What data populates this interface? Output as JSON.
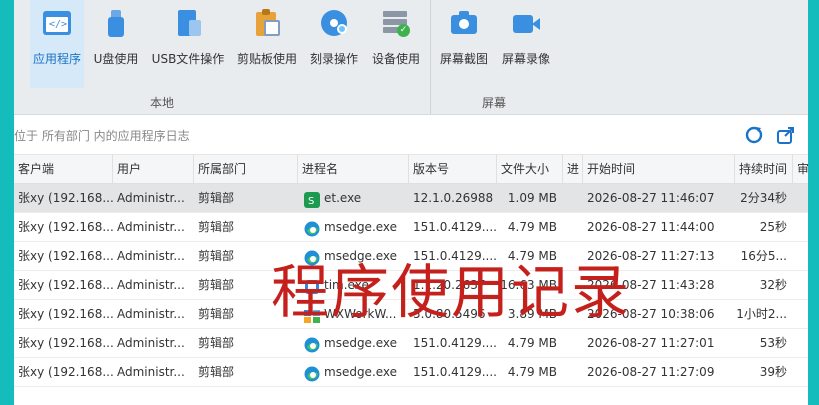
{
  "ribbon": {
    "buttons": [
      {
        "label": "应用程序",
        "icon": "code-window-icon",
        "active": true
      },
      {
        "label": "U盘使用",
        "icon": "usb-drive-icon",
        "active": false
      },
      {
        "label": "USB文件操作",
        "icon": "usb-file-icon",
        "active": false
      },
      {
        "label": "剪贴板使用",
        "icon": "clipboard-icon",
        "active": false
      },
      {
        "label": "刻录操作",
        "icon": "disc-burn-icon",
        "active": false
      },
      {
        "label": "设备使用",
        "icon": "device-check-icon",
        "active": false
      },
      {
        "label": "屏幕截图",
        "icon": "camera-icon",
        "active": false
      },
      {
        "label": "屏幕录像",
        "icon": "video-camera-icon",
        "active": false
      }
    ],
    "groups": {
      "local": "本地",
      "screen": "屏幕"
    }
  },
  "breadcrumb": {
    "text": "位于 所有部门 内的应用程序日志"
  },
  "table": {
    "headers": [
      "客户端",
      "用户",
      "所属部门",
      "进程名",
      "版本号",
      "文件大小",
      "进",
      "开始时间",
      "持续时间",
      "审"
    ],
    "rows": [
      {
        "client": "张xy (192.168....",
        "user": "Administr...",
        "dept": "剪辑部",
        "proc": "et.exe",
        "icon": "wps-sheet-icon",
        "ver": "12.1.0.26988",
        "size": "1.09 MB",
        "start": "2026-08-27 11:46:07",
        "dur": "2分34秒"
      },
      {
        "client": "张xy (192.168....",
        "user": "Administr...",
        "dept": "剪辑部",
        "proc": "msedge.exe",
        "icon": "edge-icon",
        "ver": "151.0.4129....",
        "size": "4.79 MB",
        "start": "2026-08-27 11:44:00",
        "dur": "25秒"
      },
      {
        "client": "张xy (192.168....",
        "user": "Administr...",
        "dept": "剪辑部",
        "proc": "msedge.exe",
        "icon": "edge-icon",
        "ver": "151.0.4129....",
        "size": "4.79 MB",
        "start": "2026-08-27 11:27:13",
        "dur": "16分5..."
      },
      {
        "client": "张xy (192.168....",
        "user": "Administr...",
        "dept": "剪辑部",
        "proc": "tim.exe",
        "icon": "app-icon",
        "ver": "1.1.20.2637",
        "size": "16.63 MB",
        "start": "2026-08-27 11:43:28",
        "dur": "32秒"
      },
      {
        "client": "张xy (192.168....",
        "user": "Administr...",
        "dept": "剪辑部",
        "proc": "WXWorkW...",
        "icon": "wxwork-icon",
        "ver": "5.0.80.5496",
        "size": "3.89 MB",
        "start": "2026-08-27 10:38:06",
        "dur": "1小时2..."
      },
      {
        "client": "张xy (192.168....",
        "user": "Administr...",
        "dept": "剪辑部",
        "proc": "msedge.exe",
        "icon": "edge-icon",
        "ver": "151.0.4129....",
        "size": "4.79 MB",
        "start": "2026-08-27 11:27:01",
        "dur": "53秒"
      },
      {
        "client": "张xy (192.168....",
        "user": "Administr...",
        "dept": "剪辑部",
        "proc": "msedge.exe",
        "icon": "edge-icon",
        "ver": "151.0.4129....",
        "size": "4.79 MB",
        "start": "2026-08-27 11:27:09",
        "dur": "39秒"
      }
    ]
  },
  "overlay": {
    "text": "程序使用记录"
  },
  "colors": {
    "accent": "#1a73c8",
    "overlay": "#c4201c",
    "frame": "#14bcbc"
  }
}
